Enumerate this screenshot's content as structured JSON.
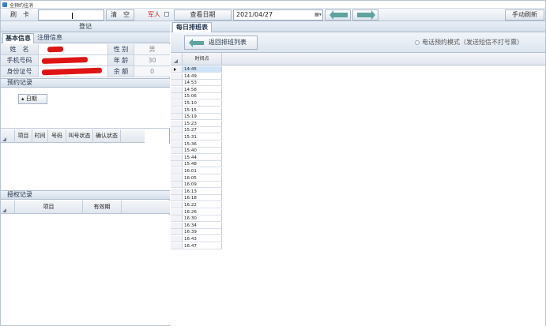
{
  "window": {
    "title": "全预约挂消"
  },
  "toolbar": {
    "swipe_card": "刷　卡",
    "card_value": "",
    "clear": "清　空",
    "military": "军人",
    "view_date": "查看日期",
    "date_value": "2021/04/27",
    "manual_refresh": "手动刷新"
  },
  "left": {
    "register": "登记",
    "tabs": [
      "基本信息",
      "注册信息"
    ],
    "info": {
      "name_label": "姓　名",
      "name_value": "",
      "gender_label": "性 别",
      "gender_value": "男",
      "phone_label": "手机号码",
      "phone_value": "",
      "age_label": "年 龄",
      "age_value": "30",
      "id_label": "身份证号",
      "id_value": "",
      "balance_label": "余 额",
      "balance_value": "0"
    },
    "appointments": {
      "title": "预约记录",
      "group_button": "日期",
      "columns": [
        "项目",
        "时间",
        "号码",
        "叫号状态",
        "确认状态"
      ]
    },
    "authorization": {
      "title": "授权记录",
      "columns": [
        "项目",
        "有效期"
      ]
    }
  },
  "right": {
    "tab": "每日排班表",
    "back_button": "返回排班列表",
    "phone_mode": "电话预约模式（发送短信不打号票）",
    "column_header": "时间点",
    "times": [
      "14:45",
      "14:49",
      "14:53",
      "14:58",
      "15:06",
      "15:10",
      "15:15",
      "15:19",
      "15:23",
      "15:27",
      "15:31",
      "15:36",
      "15:40",
      "15:44",
      "15:48",
      "16:01",
      "16:05",
      "16:09",
      "16:13",
      "16:18",
      "16:22",
      "16:26",
      "16:30",
      "16:34",
      "16:39",
      "16:43",
      "16:47"
    ]
  },
  "colors": {
    "redaction": "#e01414",
    "military_text": "#d01a1a",
    "arrow": "#5fa3a0"
  }
}
